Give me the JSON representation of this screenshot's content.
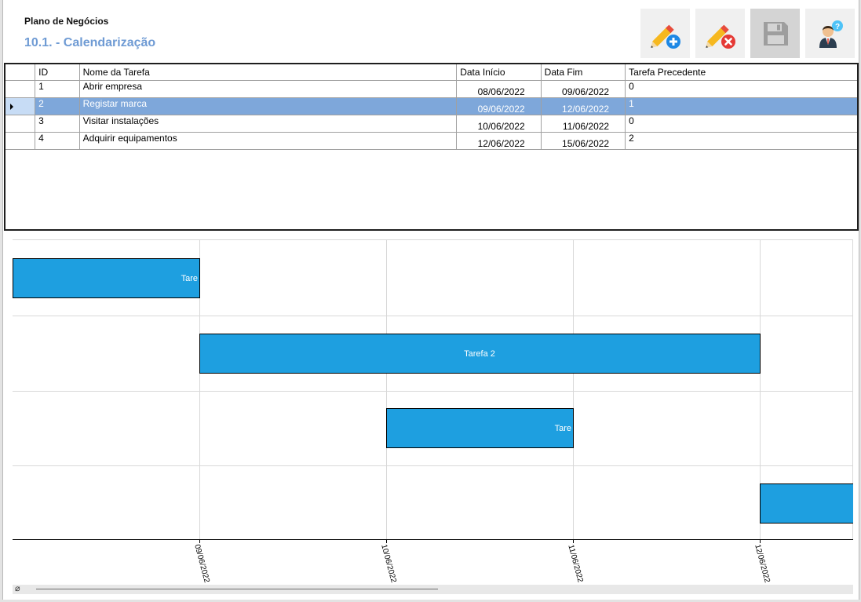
{
  "header": {
    "app_title": "Plano de Negócios",
    "section_title": "10.1. - Calendarização"
  },
  "toolbar": [
    {
      "name": "add-task-button",
      "icon": "pencil-add-icon",
      "enabled": true
    },
    {
      "name": "delete-task-button",
      "icon": "pencil-delete-icon",
      "enabled": true
    },
    {
      "name": "save-button",
      "icon": "floppy-disk-icon",
      "enabled": false
    },
    {
      "name": "help-button",
      "icon": "user-help-icon",
      "enabled": true
    }
  ],
  "grid": {
    "columns": [
      "ID",
      "Nome da Tarefa",
      "Data Início",
      "Data Fim",
      "Tarefa Precedente"
    ],
    "rows": [
      {
        "id": "1",
        "name": "Abrir empresa",
        "start": "08/06/2022",
        "end": "09/06/2022",
        "prev": "0"
      },
      {
        "id": "2",
        "name": "Registar marca",
        "start": "09/06/2022",
        "end": "12/06/2022",
        "prev": "1"
      },
      {
        "id": "3",
        "name": "Visitar instalações",
        "start": "10/06/2022",
        "end": "11/06/2022",
        "prev": "0"
      },
      {
        "id": "4",
        "name": "Adquirir equipamentos",
        "start": "12/06/2022",
        "end": "15/06/2022",
        "prev": "2"
      }
    ],
    "selected_row": 1
  },
  "gantt": {
    "bar_color": "#1e9fe0",
    "bars": [
      {
        "label": "Tare",
        "start": "08/06/2022",
        "end": "09/06/2022"
      },
      {
        "label": "Tarefa 2",
        "start": "09/06/2022",
        "end": "12/06/2022"
      },
      {
        "label": "Tare",
        "start": "10/06/2022",
        "end": "11/06/2022"
      },
      {
        "label": "",
        "start": "12/06/2022",
        "end": "15/06/2022"
      }
    ],
    "x_ticks": [
      "09/06/2022",
      "10/06/2022",
      "11/06/2022",
      "12/06/2022"
    ]
  },
  "scrollbar": {
    "glyph": "⌀"
  }
}
